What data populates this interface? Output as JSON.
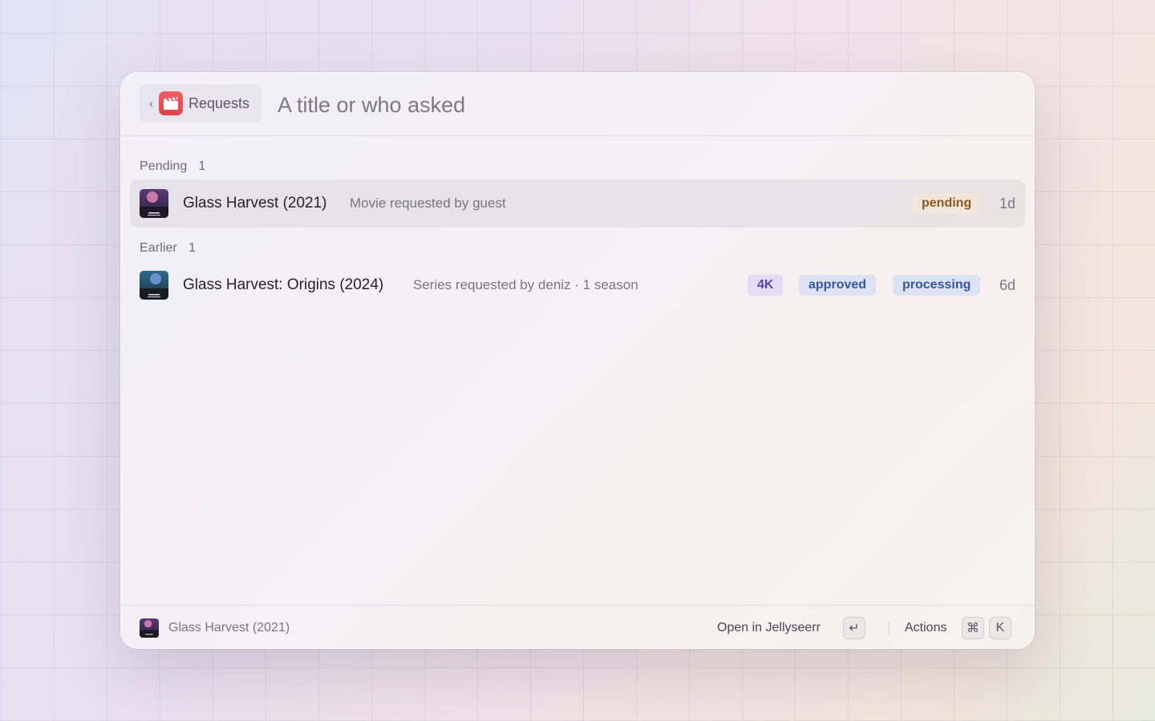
{
  "header": {
    "back_label": "Requests",
    "search_placeholder": "A title or who asked",
    "search_value": ""
  },
  "sections": [
    {
      "label": "Pending",
      "count": "1",
      "items": [
        {
          "title": "Glass Harvest (2021)",
          "subtitle": "Movie requested by guest",
          "badges": [
            "pending"
          ],
          "age": "1d",
          "poster_icon": "poster-thumbnail",
          "selected": true
        }
      ]
    },
    {
      "label": "Earlier",
      "count": "1",
      "items": [
        {
          "title": "Glass Harvest: Origins (2024)",
          "subtitle": "Series requested by deniz · 1 season",
          "badges": [
            "4K",
            "approved",
            "processing"
          ],
          "age": "6d",
          "poster_icon": "poster-thumbnail",
          "selected": false
        }
      ]
    }
  ],
  "footer": {
    "selected_title": "Glass Harvest (2021)",
    "primary_action": "Open in Jellyseerr",
    "primary_key": "↵",
    "actions_label": "Actions",
    "actions_keys": [
      "⌘",
      "K"
    ]
  },
  "colors": {
    "app_icon": "#e0434a",
    "pending_badge": "#8a5a1d",
    "4k_badge": "#5a48b0",
    "status_badge": "#3756a4"
  }
}
